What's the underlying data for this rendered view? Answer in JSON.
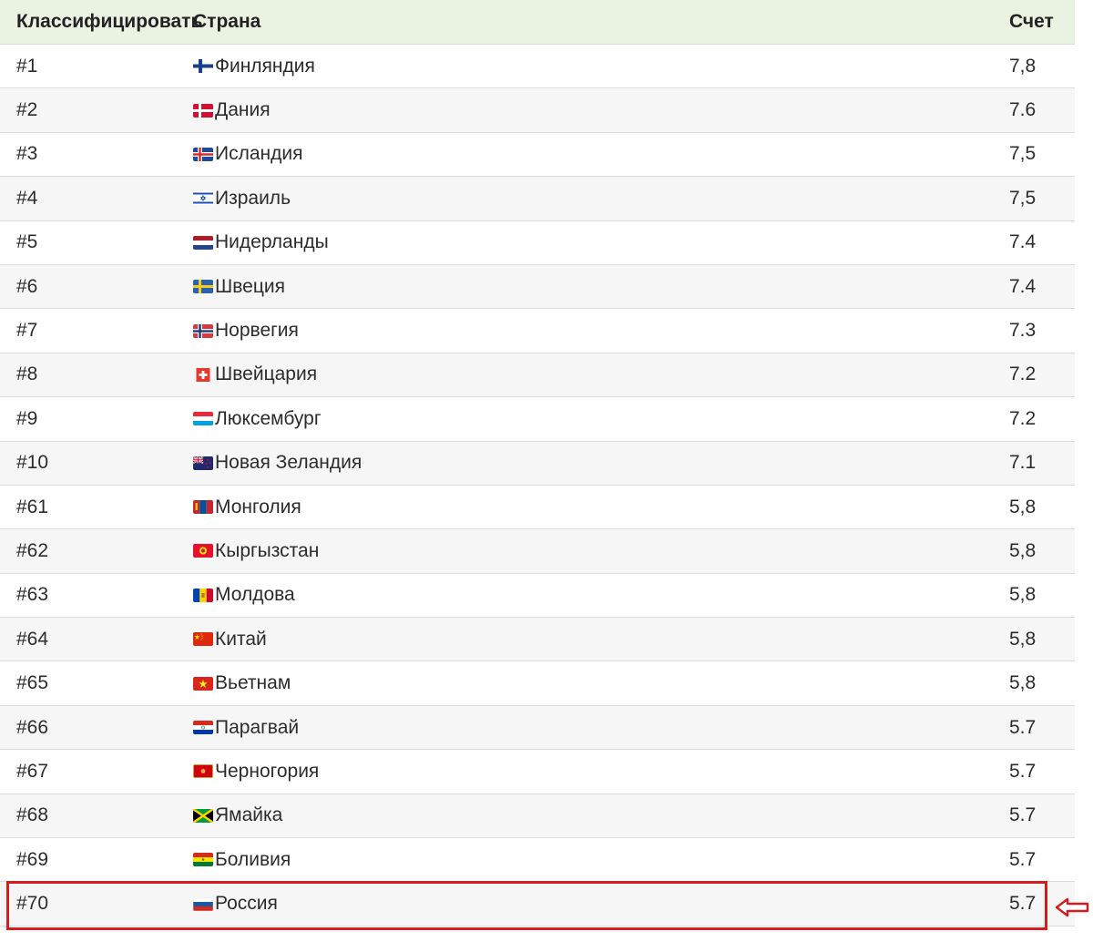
{
  "header": {
    "rank_label": "Классифицировать",
    "country_label": "Страна",
    "score_label": "Счет"
  },
  "rows": [
    {
      "rank": "#1",
      "country": "Финляндия",
      "score": "7,8",
      "flag": "finland-flag"
    },
    {
      "rank": "#2",
      "country": "Дания",
      "score": "7.6",
      "flag": "denmark-flag"
    },
    {
      "rank": "#3",
      "country": "Исландия",
      "score": "7,5",
      "flag": "iceland-flag"
    },
    {
      "rank": "#4",
      "country": "Израиль",
      "score": "7,5",
      "flag": "israel-flag"
    },
    {
      "rank": "#5",
      "country": "Нидерланды",
      "score": "7.4",
      "flag": "netherlands-flag"
    },
    {
      "rank": "#6",
      "country": "Швеция",
      "score": "7.4",
      "flag": "sweden-flag"
    },
    {
      "rank": "#7",
      "country": "Норвегия",
      "score": "7.3",
      "flag": "norway-flag"
    },
    {
      "rank": "#8",
      "country": "Швейцария",
      "score": "7.2",
      "flag": "switzerland-flag"
    },
    {
      "rank": "#9",
      "country": "Люксембург",
      "score": "7.2",
      "flag": "luxembourg-flag"
    },
    {
      "rank": "#10",
      "country": "Новая Зеландия",
      "score": "7.1",
      "flag": "new-zealand-flag"
    },
    {
      "rank": "#61",
      "country": "Монголия",
      "score": "5,8",
      "flag": "mongolia-flag"
    },
    {
      "rank": "#62",
      "country": "Кыргызстан",
      "score": "5,8",
      "flag": "kyrgyzstan-flag"
    },
    {
      "rank": "#63",
      "country": "Молдова",
      "score": "5,8",
      "flag": "moldova-flag"
    },
    {
      "rank": "#64",
      "country": "Китай",
      "score": "5,8",
      "flag": "china-flag"
    },
    {
      "rank": "#65",
      "country": "Вьетнам",
      "score": "5,8",
      "flag": "vietnam-flag"
    },
    {
      "rank": "#66",
      "country": "Парагвай",
      "score": "5.7",
      "flag": "paraguay-flag"
    },
    {
      "rank": "#67",
      "country": "Черногория",
      "score": "5.7",
      "flag": "montenegro-flag"
    },
    {
      "rank": "#68",
      "country": "Ямайка",
      "score": "5.7",
      "flag": "jamaica-flag"
    },
    {
      "rank": "#69",
      "country": "Боливия",
      "score": "5.7",
      "flag": "bolivia-flag"
    },
    {
      "rank": "#70",
      "country": "Россия",
      "score": "5.7",
      "flag": "russia-flag"
    }
  ],
  "highlight": {
    "row_rank": "#70",
    "color": "#d71920"
  },
  "colors": {
    "header_bg": "#eaf3e2",
    "row_alt_bg": "#f6f6f6",
    "border": "#dcdcdc"
  }
}
